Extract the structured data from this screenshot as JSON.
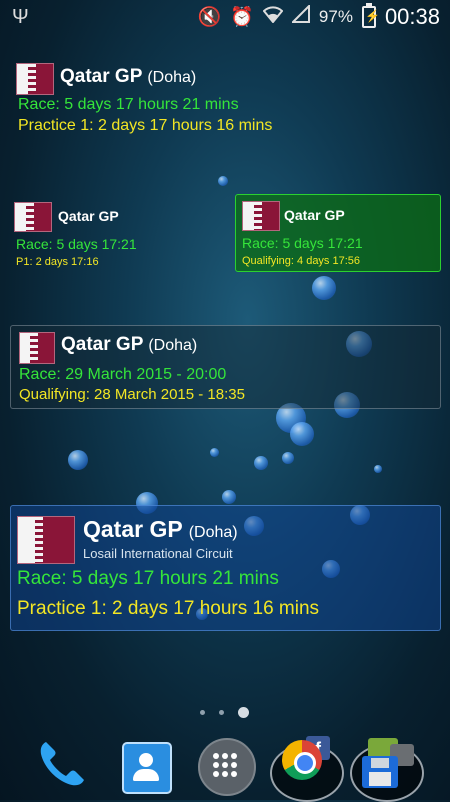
{
  "status_bar": {
    "usb_icon": "usb-icon",
    "battery_percent": "97%",
    "time": "00:38",
    "icons": [
      "mute-icon",
      "alarm-icon",
      "wifi-icon",
      "signal-icon",
      "battery-charging-icon"
    ]
  },
  "widgets": [
    {
      "title": "Qatar GP",
      "city": "(Doha)",
      "line1": "Race:  5 days 17 hours 21 mins",
      "line2": "Practice 1:  2 days 17 hours 16 mins"
    },
    {
      "title": "Qatar GP",
      "line1": "Race:  5 days 17:21",
      "line2": "P1:  2 days 17:16"
    },
    {
      "title": "Qatar GP",
      "line1": "Race:  5 days 17:21",
      "line2": "Qualifying:  4 days 17:56"
    },
    {
      "title": "Qatar GP",
      "city": "(Doha)",
      "line1": "Race:  29 March 2015 - 20:00",
      "line2": "Qualifying:  28 March 2015 - 18:35"
    },
    {
      "title": "Qatar GP",
      "city": "(Doha)",
      "circuit": "Losail International Circuit",
      "line1": "Race:  5 days 17 hours 21 mins",
      "line2": "Practice 1:  2 days 17 hours 16 mins"
    }
  ],
  "page_indicator": {
    "pages": 3,
    "active": 3
  },
  "dock": {
    "items": [
      "phone-icon",
      "contacts-icon",
      "app-drawer-icon",
      "chrome-folder-icon",
      "files-folder-icon"
    ],
    "facebook_letter": "f"
  },
  "colors": {
    "race": "#35e53a",
    "session": "#f2e624",
    "flag_maroon": "#8a1538"
  }
}
